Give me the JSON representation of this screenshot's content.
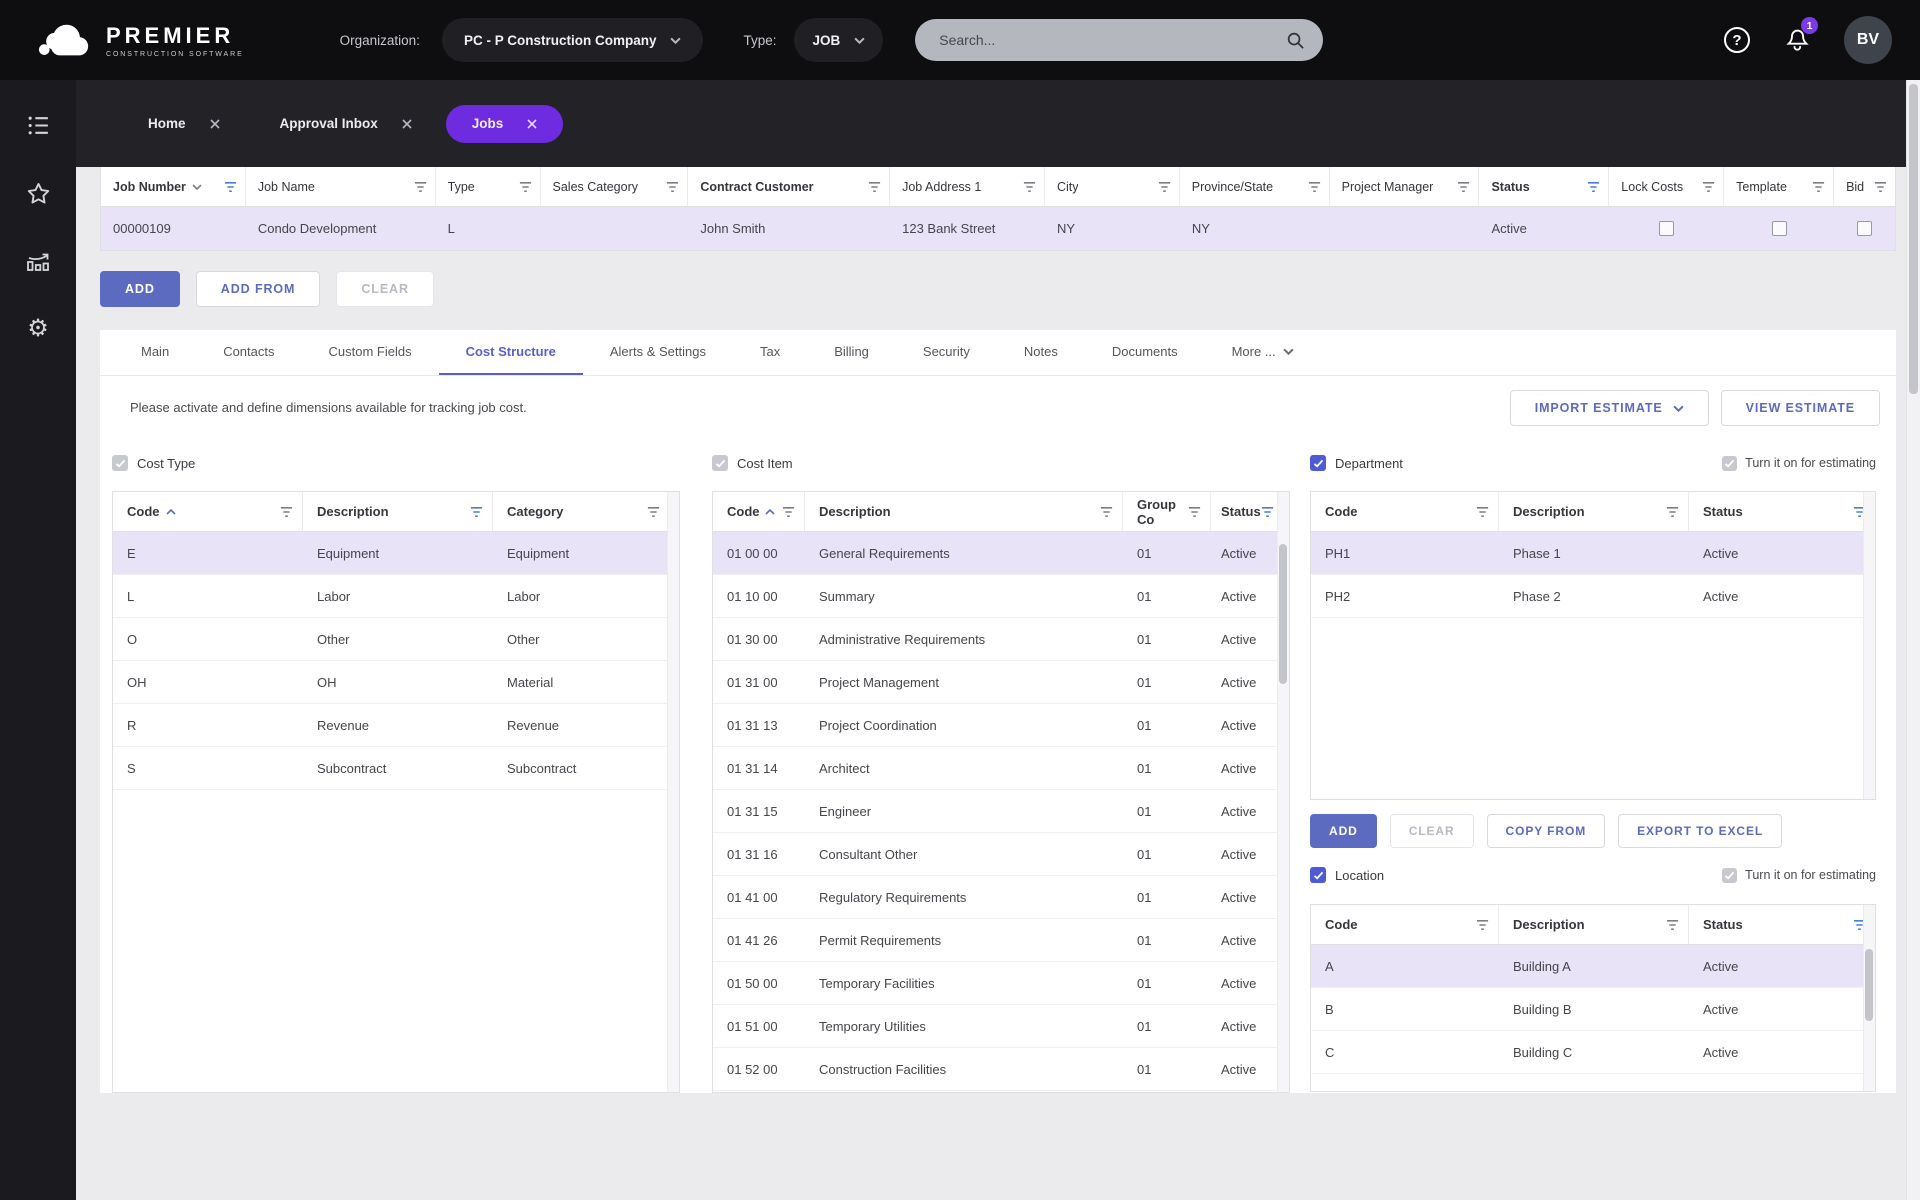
{
  "header": {
    "brand_name": "PREMIER",
    "brand_tagline": "CONSTRUCTION SOFTWARE",
    "organization_label": "Organization:",
    "organization_value": "PC - P Construction Company",
    "type_label": "Type:",
    "type_value": "JOB",
    "search_placeholder": "Search...",
    "notification_badge": "1",
    "avatar_initials": "BV"
  },
  "icons": {
    "help_glyph": "?",
    "gear_glyph": "⚙"
  },
  "workspace_tabs": [
    {
      "label": "Home"
    },
    {
      "label": "Approval Inbox"
    },
    {
      "label": "Jobs"
    }
  ],
  "jobs_grid": {
    "columns": [
      "Job Number",
      "Job Name",
      "Type",
      "Sales Category",
      "Contract Customer",
      "Job Address 1",
      "City",
      "Province/State",
      "Project Manager",
      "Status",
      "Lock Costs",
      "Template",
      "Bid"
    ],
    "row": {
      "job_number": "00000109",
      "job_name": "Condo Development",
      "type": "L",
      "sales_category": "",
      "contract_customer": "John Smith",
      "job_address_1": "123 Bank Street",
      "city": "NY",
      "province_state": "NY",
      "project_manager": "",
      "status": "Active"
    }
  },
  "actions": {
    "add": "ADD",
    "add_from": "ADD FROM",
    "clear": "CLEAR"
  },
  "detail_tabs": [
    "Main",
    "Contacts",
    "Custom Fields",
    "Cost Structure",
    "Alerts & Settings",
    "Tax",
    "Billing",
    "Security",
    "Notes",
    "Documents",
    "More ..."
  ],
  "cost_structure": {
    "instruction": "Please activate and define dimensions available for tracking job cost.",
    "import_estimate_label": "IMPORT ESTIMATE",
    "view_estimate_label": "VIEW ESTIMATE",
    "estimating_toggle_label": "Turn it on for estimating",
    "cost_type": {
      "title": "Cost Type",
      "columns": [
        "Code",
        "Description",
        "Category"
      ],
      "rows": [
        {
          "code": "E",
          "description": "Equipment",
          "category": "Equipment"
        },
        {
          "code": "L",
          "description": "Labor",
          "category": "Labor"
        },
        {
          "code": "O",
          "description": "Other",
          "category": "Other"
        },
        {
          "code": "OH",
          "description": "OH",
          "category": "Material"
        },
        {
          "code": "R",
          "description": "Revenue",
          "category": "Revenue"
        },
        {
          "code": "S",
          "description": "Subcontract",
          "category": "Subcontract"
        }
      ]
    },
    "cost_item": {
      "title": "Cost Item",
      "columns": [
        "Code",
        "Description",
        "Group Co",
        "Status"
      ],
      "rows": [
        {
          "code": "01 00 00",
          "description": "General Requirements",
          "group_co": "01",
          "status": "Active"
        },
        {
          "code": "01 10 00",
          "description": "Summary",
          "group_co": "01",
          "status": "Active"
        },
        {
          "code": "01 30 00",
          "description": "Administrative Requirements",
          "group_co": "01",
          "status": "Active"
        },
        {
          "code": "01 31 00",
          "description": "Project Management",
          "group_co": "01",
          "status": "Active"
        },
        {
          "code": "01 31 13",
          "description": "Project Coordination",
          "group_co": "01",
          "status": "Active"
        },
        {
          "code": "01 31 14",
          "description": "Architect",
          "group_co": "01",
          "status": "Active"
        },
        {
          "code": "01 31 15",
          "description": "Engineer",
          "group_co": "01",
          "status": "Active"
        },
        {
          "code": "01 31 16",
          "description": "Consultant Other",
          "group_co": "01",
          "status": "Active"
        },
        {
          "code": "01 41 00",
          "description": "Regulatory Requirements",
          "group_co": "01",
          "status": "Active"
        },
        {
          "code": "01 41 26",
          "description": "Permit Requirements",
          "group_co": "01",
          "status": "Active"
        },
        {
          "code": "01 50 00",
          "description": "Temporary Facilities",
          "group_co": "01",
          "status": "Active"
        },
        {
          "code": "01 51 00",
          "description": "Temporary Utilities",
          "group_co": "01",
          "status": "Active"
        },
        {
          "code": "01 52 00",
          "description": "Construction Facilities",
          "group_co": "01",
          "status": "Active"
        }
      ]
    },
    "department": {
      "title": "Department",
      "columns": [
        "Code",
        "Description",
        "Status"
      ],
      "rows": [
        {
          "code": "PH1",
          "description": "Phase 1",
          "status": "Active"
        },
        {
          "code": "PH2",
          "description": "Phase 2",
          "status": "Active"
        }
      ],
      "buttons": {
        "add": "ADD",
        "clear": "CLEAR",
        "copy_from": "COPY FROM",
        "export_excel": "EXPORT TO EXCEL"
      }
    },
    "location": {
      "title": "Location",
      "columns": [
        "Code",
        "Description",
        "Status"
      ],
      "rows": [
        {
          "code": "A",
          "description": "Building A",
          "status": "Active"
        },
        {
          "code": "B",
          "description": "Building B",
          "status": "Active"
        },
        {
          "code": "C",
          "description": "Building C",
          "status": "Active"
        }
      ]
    }
  },
  "colors": {
    "active_tab_accent": "#6E2BE0",
    "primary_button": "#5C6BC0",
    "active_filter": "#4A7DD2",
    "selected_row": "#E8E3F7",
    "notification_badge": "#7C3AED"
  }
}
